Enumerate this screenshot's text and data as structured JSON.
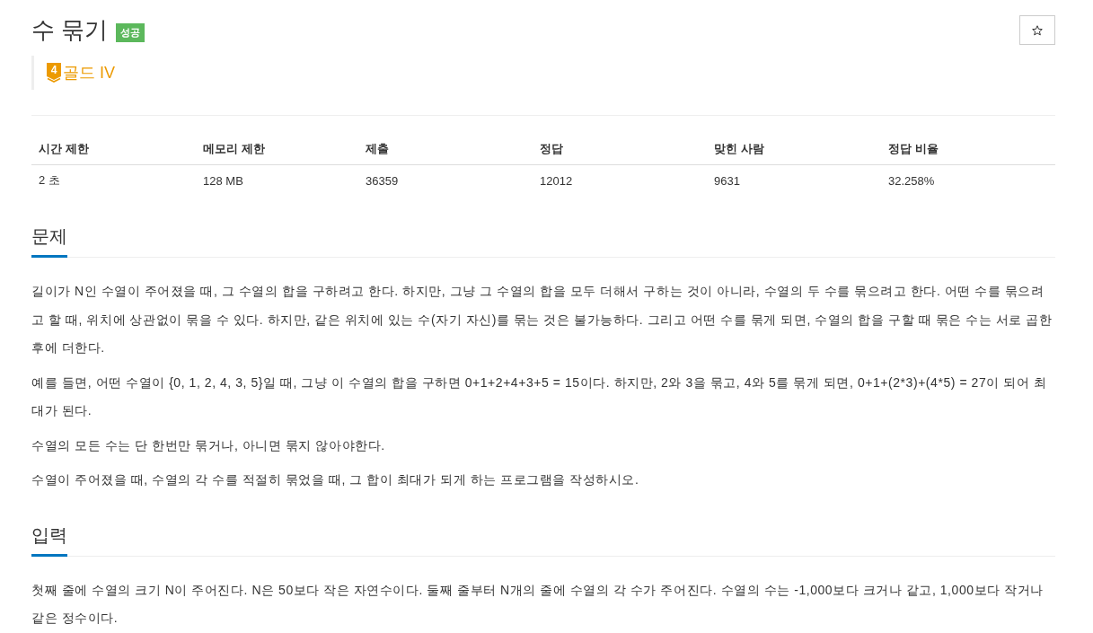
{
  "problem": {
    "title": "수 묶기",
    "status_badge": "성공",
    "tier": {
      "badge_number": "4",
      "label": "골드 IV"
    },
    "star_button": {
      "starred": false
    }
  },
  "stats": {
    "columns": [
      "시간 제한",
      "메모리 제한",
      "제출",
      "정답",
      "맞힌 사람",
      "정답 비율"
    ],
    "rows": [
      [
        "2 초",
        "128 MB",
        "36359",
        "12012",
        "9631",
        "32.258%"
      ]
    ]
  },
  "sections": [
    {
      "heading": "문제",
      "paragraphs": [
        "길이가 N인 수열이 주어졌을 때, 그 수열의 합을 구하려고 한다. 하지만, 그냥 그 수열의 합을 모두 더해서 구하는 것이 아니라, 수열의 두 수를 묶으려고 한다. 어떤 수를 묶으려고 할 때, 위치에 상관없이 묶을 수 있다. 하지만, 같은 위치에 있는 수(자기 자신)를 묶는 것은 불가능하다. 그리고 어떤 수를 묶게 되면, 수열의 합을 구할 때 묶은 수는 서로 곱한 후에 더한다.",
        "예를 들면, 어떤 수열이 {0, 1, 2, 4, 3, 5}일 때, 그냥 이 수열의 합을 구하면 0+1+2+4+3+5 = 15이다. 하지만, 2와 3을 묶고, 4와 5를 묶게 되면, 0+1+(2*3)+(4*5) = 27이 되어 최대가 된다.",
        "수열의 모든 수는 단 한번만 묶거나, 아니면 묶지 않아야한다.",
        "수열이 주어졌을 때, 수열의 각 수를 적절히 묶었을 때, 그 합이 최대가 되게 하는 프로그램을 작성하시오."
      ]
    },
    {
      "heading": "입력",
      "paragraphs": [
        "첫째 줄에 수열의 크기 N이 주어진다. N은 50보다 작은 자연수이다. 둘째 줄부터 N개의 줄에 수열의 각 수가 주어진다. 수열의 수는 -1,000보다 크거나 같고, 1,000보다 작거나 같은 정수이다."
      ]
    }
  ]
}
